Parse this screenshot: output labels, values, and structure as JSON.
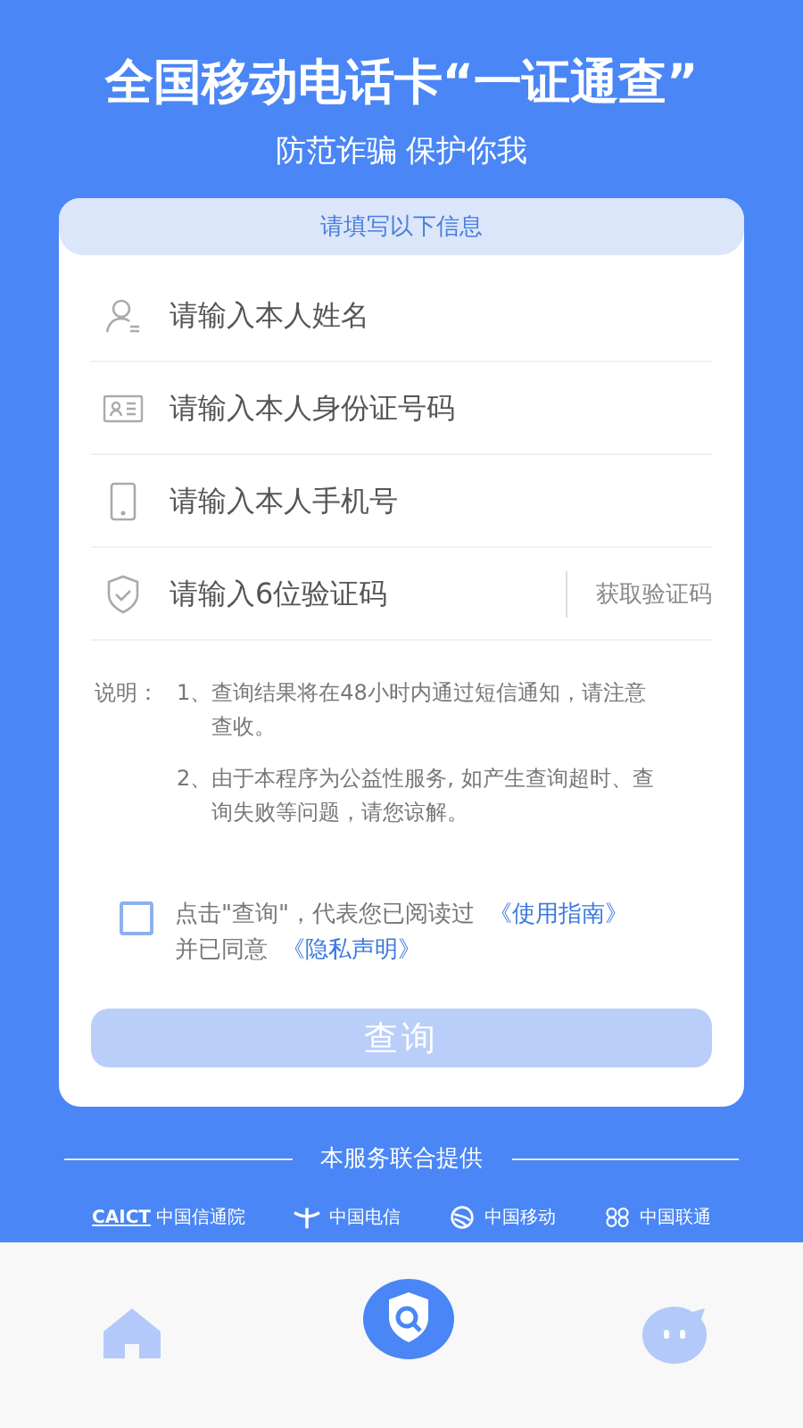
{
  "header": {
    "title": "全国移动电话卡“一证通查”",
    "subtitle": "防范诈骗 保护你我"
  },
  "form": {
    "heading": "请填写以下信息",
    "fields": [
      {
        "kind": "name",
        "placeholder": "请输入本人姓名"
      },
      {
        "kind": "id",
        "placeholder": "请输入本人身份证号码"
      },
      {
        "kind": "phone",
        "placeholder": "请输入本人手机号"
      },
      {
        "kind": "code",
        "placeholder": "请输入6位验证码",
        "action": "获取验证码"
      }
    ],
    "notes_label": "说明：",
    "notes": [
      {
        "number": "1、",
        "text": "查询结果将在48小时内通过短信通知，请注意查收。"
      },
      {
        "number": "2、",
        "text": "由于本程序为公益性服务, 如产生查询超时、查询失败等问题，请您谅解。"
      }
    ],
    "agreement": {
      "checked": false,
      "text": "点击\"查询\"，代表您已阅读过",
      "link1": "《使用指南》",
      "text2": "并已同意",
      "link2": "《隐私声明》"
    },
    "submit": {
      "label": "查询",
      "disabled": true
    }
  },
  "providers": {
    "heading": "本服务联合提供",
    "logos": [
      {
        "kind": "caict",
        "mark": "CAICT",
        "name": "中国信通院"
      },
      {
        "kind": "telecom",
        "name": "中国电信"
      },
      {
        "kind": "mobile",
        "name": "中国移动"
      },
      {
        "kind": "unicom",
        "name": "中国联通"
      }
    ]
  },
  "nav": [
    {
      "kind": "home"
    },
    {
      "kind": "query"
    },
    {
      "kind": "chat"
    }
  ]
}
